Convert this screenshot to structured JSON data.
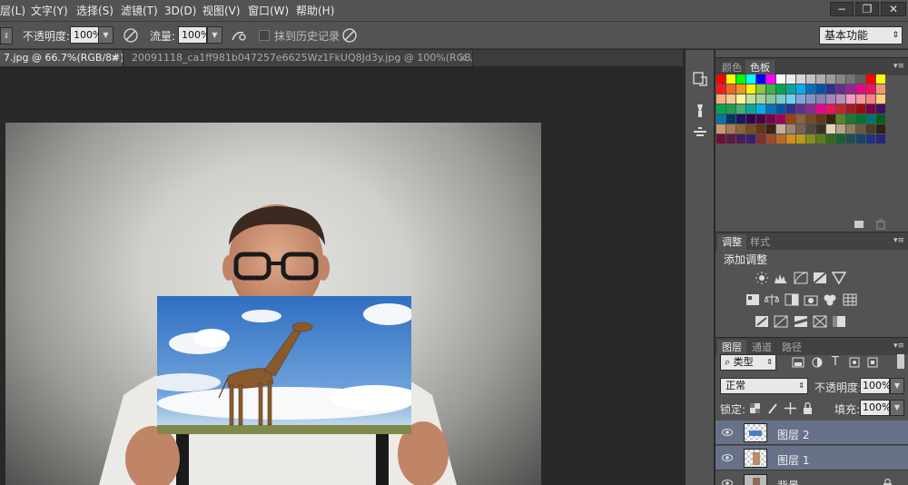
{
  "menubar": {
    "items": [
      "层(L)",
      "文字(Y)",
      "选择(S)",
      "滤镜(T)",
      "3D(D)",
      "视图(V)",
      "窗口(W)",
      "帮助(H)"
    ],
    "window_controls": [
      "−",
      "❐",
      "✕"
    ]
  },
  "options": {
    "opacity_label": "不透明度:",
    "opacity_value": "100%",
    "flow_label": "流量:",
    "flow_value": "100%",
    "history_label": "抹到历史记录",
    "workspace": "基本功能"
  },
  "tabs": [
    {
      "label": "7.jpg @ 66.7%(RGB/8#) *",
      "active": true,
      "close": "×"
    },
    {
      "label": "20091118_ca1ff981b047257e6625Wz1FkUQ8Jd3y.jpg @ 100%(RGB/8#) *",
      "active": false,
      "close": "×"
    }
  ],
  "color_panel": {
    "tabs": [
      "颜色",
      "色板"
    ],
    "active_tab": "色板"
  },
  "adjust_panel": {
    "tabs": [
      "调整",
      "样式"
    ],
    "title": "添加调整"
  },
  "layers_panel": {
    "tabs": [
      "图层",
      "通道",
      "路径"
    ],
    "filter_label": "类型",
    "blend_mode": "正常",
    "opacity_label": "不透明度:",
    "opacity_value": "100%",
    "lock_label": "锁定:",
    "fill_label": "填充:",
    "fill_value": "100%",
    "layers": [
      {
        "name": "图层 2",
        "selected": true
      },
      {
        "name": "图层 1",
        "selected": true
      },
      {
        "name": "背景",
        "selected": false
      }
    ]
  },
  "colors": {
    "ui_bg": "#535353",
    "canvas_bg": "#282828",
    "selection": "#677289"
  },
  "swatch_rows": [
    [
      "#ff0000",
      "#ffff00",
      "#00ff00",
      "#00ffff",
      "#0000ff",
      "#ff00ff",
      "#ffffff",
      "#ebebeb",
      "#d7d7d7",
      "#c3c3c3",
      "#afafaf",
      "#9b9b9b",
      "#878787",
      "#737373",
      "#5f5f5f",
      "#ff0000",
      "#ffff00"
    ],
    [
      "#ee1c24",
      "#f26522",
      "#f7941d",
      "#fff200",
      "#8dc63f",
      "#39b54a",
      "#00a651",
      "#00a99d",
      "#00aeef",
      "#0072bc",
      "#0054a6",
      "#2e3192",
      "#662d91",
      "#92278f",
      "#ec008c",
      "#ed145b",
      "#f7977a"
    ],
    [
      "#f9ad81",
      "#fdc68a",
      "#fff79a",
      "#c4df9b",
      "#a3d39c",
      "#82ca9d",
      "#7accc8",
      "#6dcff6",
      "#7da7d9",
      "#8393ca",
      "#8781bd",
      "#a187be",
      "#bc8dbf",
      "#f49ac2",
      "#f6989d",
      "#ff8080",
      "#ffd080"
    ],
    [
      "#00a651",
      "#1a9f4c",
      "#3cb371",
      "#00a99d",
      "#00aeef",
      "#0072bc",
      "#0054a6",
      "#2e3192",
      "#662d91",
      "#92278f",
      "#ec008c",
      "#ed145b",
      "#c4262e",
      "#a31c21",
      "#9e0b0f",
      "#7b0046",
      "#440e62"
    ],
    [
      "#0076a3",
      "#003663",
      "#1b1464",
      "#32004b",
      "#4b0049",
      "#7b0046",
      "#9e005d",
      "#a0410d",
      "#8c6239",
      "#754c24",
      "#603913",
      "#3c2415",
      "#598527",
      "#197b30",
      "#007236",
      "#00746b",
      "#005e20"
    ],
    [
      "#c69c6d",
      "#a67c52",
      "#8c6239",
      "#754c24",
      "#603913",
      "#3c2415",
      "#c7b299",
      "#998675",
      "#736357",
      "#534741",
      "#37302a",
      "#e1d3b5",
      "#b5a583",
      "#8e7d5e",
      "#6a5b3f",
      "#4a3d25",
      "#2b2414"
    ],
    [
      "#6b0f3b",
      "#5a1b46",
      "#4a1a5a",
      "#3a1e6a",
      "#80302e",
      "#9e4d2a",
      "#bc6a1f",
      "#d98a1a",
      "#b79b1a",
      "#8c8c1a",
      "#5e7d1a",
      "#306b1a",
      "#1a5e38",
      "#1a5050",
      "#1a4266",
      "#1a3480",
      "#26267a"
    ]
  ]
}
